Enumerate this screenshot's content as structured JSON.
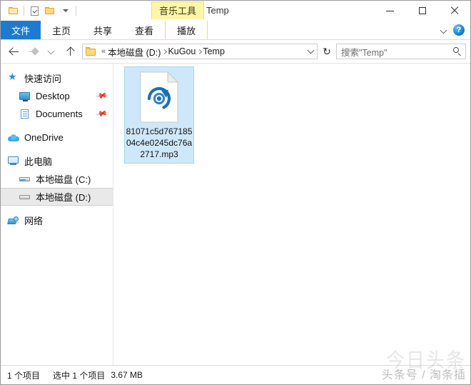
{
  "window": {
    "title": "Temp",
    "contextual_tab_group": "音乐工具"
  },
  "quick_access_toolbar": {
    "items": [
      {
        "name": "folder-properties",
        "icon": "folder-icon"
      },
      {
        "name": "properties",
        "icon": "properties-checkbox-icon"
      },
      {
        "name": "new-folder",
        "icon": "new-folder-icon"
      },
      {
        "name": "customize",
        "icon": "chevron-down-icon"
      }
    ]
  },
  "window_controls": {
    "minimize": "—",
    "maximize": "□",
    "close": "✕"
  },
  "ribbon": {
    "tabs": [
      {
        "label": "文件",
        "selected": true,
        "type": "file"
      },
      {
        "label": "主页",
        "selected": false,
        "type": "normal"
      },
      {
        "label": "共享",
        "selected": false,
        "type": "normal"
      },
      {
        "label": "查看",
        "selected": false,
        "type": "normal"
      },
      {
        "label": "播放",
        "selected": false,
        "type": "contextual"
      }
    ],
    "expand_label": "",
    "help_label": "?"
  },
  "address_bar": {
    "back": "←",
    "forward": "→",
    "recent": "⌄",
    "up": "↑",
    "overflow": "«",
    "breadcrumbs": [
      {
        "label": "本地磁盘 (D:)"
      },
      {
        "label": "KuGou"
      },
      {
        "label": "Temp"
      }
    ],
    "refresh": "↻"
  },
  "search": {
    "placeholder": "搜索\"Temp\"",
    "value": "",
    "icon": "search-icon"
  },
  "sidebar": {
    "items": [
      {
        "label": "快速访问",
        "icon": "star-icon",
        "level": 1,
        "selected": false,
        "pinned": false
      },
      {
        "label": "Desktop",
        "icon": "desktop-icon",
        "level": 2,
        "selected": false,
        "pinned": true
      },
      {
        "label": "Documents",
        "icon": "documents-icon",
        "level": 2,
        "selected": false,
        "pinned": true
      },
      {
        "label": "OneDrive",
        "icon": "cloud-icon",
        "level": 1,
        "selected": false,
        "pinned": false
      },
      {
        "label": "此电脑",
        "icon": "this-pc-icon",
        "level": 1,
        "selected": false,
        "pinned": false
      },
      {
        "label": "本地磁盘 (C:)",
        "icon": "system-drive-icon",
        "level": 2,
        "selected": false,
        "pinned": false
      },
      {
        "label": "本地磁盘 (D:)",
        "icon": "drive-icon",
        "level": 2,
        "selected": true,
        "pinned": false
      },
      {
        "label": "网络",
        "icon": "network-icon",
        "level": 1,
        "selected": false,
        "pinned": false
      }
    ]
  },
  "content": {
    "files": [
      {
        "name": "81071c5d76718504c4e0245dc76a2717.mp3",
        "icon": "music-file-icon",
        "selected": true
      }
    ]
  },
  "status_bar": {
    "item_count": "1 个项目",
    "selection": "选中 1 个项目",
    "size": "3.67 MB"
  },
  "watermark": {
    "logo": "今日头条",
    "text": "头条号 / 淘条插"
  },
  "colors": {
    "file_tab_blue": "#1e7ad1",
    "contextual_yellow": "#fdf6a8",
    "selection_blue": "#cfe8f9",
    "folder_yellow": "#fdd97a"
  }
}
